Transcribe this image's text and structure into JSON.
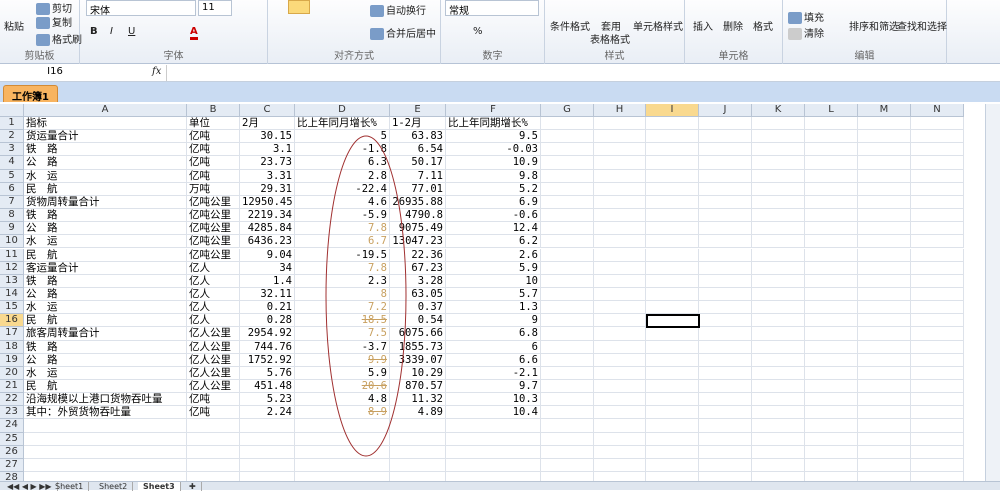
{
  "ribbon": {
    "clipboard": {
      "paste": "粘贴",
      "cut": "剪切",
      "copy": "复制",
      "format_painter": "格式刷",
      "label": "剪贴板"
    },
    "font": {
      "name": "宋体",
      "size": "11",
      "label": "字体",
      "bold": "B",
      "italic": "I",
      "underline": "U"
    },
    "alignment": {
      "wrap": "自动换行",
      "merge": "合并后居中",
      "label": "对齐方式"
    },
    "number": {
      "format": "常规",
      "percent": "%",
      "comma": ",",
      "label": "数字"
    },
    "styles": {
      "conditional": "条件格式",
      "table_line1": "套用",
      "table_line2": "表格格式",
      "cell_styles": "单元格样式",
      "label": "样式"
    },
    "cells": {
      "insert": "插入",
      "delete": "删除",
      "format": "格式",
      "label": "单元格"
    },
    "editing": {
      "fill": "填充",
      "clear": "清除",
      "sort": "排序和筛选",
      "find": "查找和选择",
      "label": "编辑"
    }
  },
  "formula_bar": {
    "name_box": "I16",
    "fx": "fx",
    "value": ""
  },
  "workbook_tab": "工作簿1",
  "columns": [
    "A",
    "B",
    "C",
    "D",
    "E",
    "F",
    "G",
    "H",
    "I",
    "J",
    "K",
    "L",
    "M",
    "N"
  ],
  "selected": {
    "col": "I",
    "row": 16
  },
  "rows": [
    [
      "指标",
      "单位",
      "2月",
      "比上年同月增长%",
      "1-2月",
      "比上年同期增长%"
    ],
    [
      "货运量合计",
      "亿吨",
      "30.15",
      "5",
      "63.83",
      "9.5"
    ],
    [
      "铁　路",
      "亿吨",
      "3.1",
      "-1.8",
      "6.54",
      "-0.03"
    ],
    [
      "公　路",
      "亿吨",
      "23.73",
      "6.3",
      "50.17",
      "10.9"
    ],
    [
      "水　运",
      "亿吨",
      "3.31",
      "2.8",
      "7.11",
      "9.8"
    ],
    [
      "民　航",
      "万吨",
      "29.31",
      "-22.4",
      "77.01",
      "5.2"
    ],
    [
      "货物周转量合计",
      "亿吨公里",
      "12950.45",
      "4.6",
      "26935.88",
      "6.9"
    ],
    [
      "铁　路",
      "亿吨公里",
      "2219.34",
      "-5.9",
      "4790.8",
      "-0.6"
    ],
    [
      "公　路",
      "亿吨公里",
      "4285.84",
      "7.8",
      "9075.49",
      "12.4"
    ],
    [
      "水　运",
      "亿吨公里",
      "6436.23",
      "6.7",
      "13047.23",
      "6.2"
    ],
    [
      "民　航",
      "亿吨公里",
      "9.04",
      "-19.5",
      "22.36",
      "2.6"
    ],
    [
      "客运量合计",
      "亿人",
      "34",
      "7.8",
      "67.23",
      "5.9"
    ],
    [
      "铁　路",
      "亿人",
      "1.4",
      "2.3",
      "3.28",
      "10"
    ],
    [
      "公　路",
      "亿人",
      "32.11",
      "8",
      "63.05",
      "5.7"
    ],
    [
      "水　运",
      "亿人",
      "0.21",
      "7.2",
      "0.37",
      "1.3"
    ],
    [
      "民　航",
      "亿人",
      "0.28",
      "18.5",
      "0.54",
      "9"
    ],
    [
      "旅客周转量合计",
      "亿人公里",
      "2954.92",
      "7.5",
      "6075.66",
      "6.8"
    ],
    [
      "铁　路",
      "亿人公里",
      "744.76",
      "-3.7",
      "1855.73",
      "6"
    ],
    [
      "公　路",
      "亿人公里",
      "1752.92",
      "9.9",
      "3339.07",
      "6.6"
    ],
    [
      "水　运",
      "亿人公里",
      "5.76",
      "5.9",
      "10.29",
      "-2.1"
    ],
    [
      "民　航",
      "亿人公里",
      "451.48",
      "20.6",
      "870.57",
      "9.7"
    ],
    [
      "沿海规模以上港口货物吞吐量",
      "亿吨",
      "5.23",
      "4.8",
      "11.32",
      "10.3"
    ],
    [
      "其中：外贸货物吞吐量",
      "亿吨",
      "2.24",
      "8.9",
      "4.89",
      "10.4"
    ]
  ],
  "tan_rows": [
    9,
    10,
    12,
    14,
    15,
    16,
    17,
    19,
    21,
    23
  ],
  "strike_rows": [
    16,
    19,
    21,
    23
  ],
  "total_rows": 28,
  "sheet_tabs": [
    "Sheet1",
    "Sheet2",
    "Sheet3"
  ],
  "active_sheet": "Sheet3",
  "colors": {
    "tan": "#c8a060",
    "annotation": "#a03030",
    "selected_header": "#f9d98f"
  }
}
